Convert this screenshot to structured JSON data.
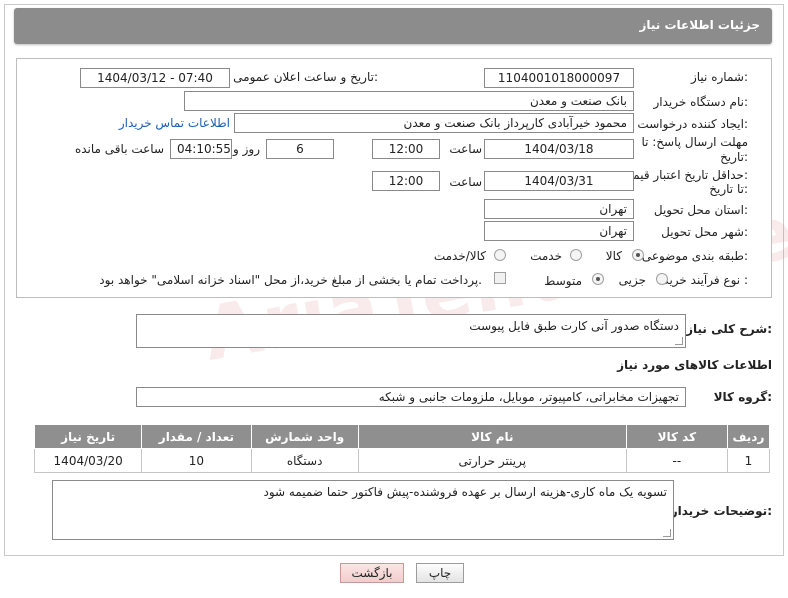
{
  "header": {
    "title": "جزئیات اطلاعات نیاز"
  },
  "form": {
    "need_number_label": "شماره نیاز:",
    "need_number": "1104001018000097",
    "announce_datetime_label": "تاریخ و ساعت اعلان عمومی:",
    "announce_datetime": "1404/03/12 - 07:40",
    "buyer_org_label": "نام دستگاه خریدار:",
    "buyer_org": "بانک صنعت و معدن",
    "requester_label": "ایجاد کننده درخواست:",
    "requester": "محمود خیرآبادی کارپرداز بانک صنعت و معدن",
    "buyer_contact_link": "اطلاعات تماس خریدار",
    "reply_deadline_label_1": "مهلت ارسال پاسخ: تا",
    "reply_deadline_label_2": "تاریخ:",
    "reply_date": "1404/03/18",
    "time_label": "ساعت",
    "reply_time": "12:00",
    "days_value": "6",
    "days_label": "روز و",
    "remaining_time": "04:10:55",
    "remaining_label": "ساعت باقی مانده",
    "price_validity_label_1": "حداقل تاریخ اعتبار قیمت:",
    "price_validity_label_2": "تا تاریخ:",
    "price_date": "1404/03/31",
    "price_time": "12:00",
    "province_label": "استان محل تحویل:",
    "province": "تهران",
    "city_label": "شهر محل تحویل:",
    "city": "تهران",
    "category_label": "طبقه بندی موضوعی:",
    "category_options": [
      "کالا",
      "خدمت",
      "کالا/خدمت"
    ],
    "purchase_type_label": "نوع فرآیند خرید :",
    "purchase_options": [
      "جزیی",
      "متوسط"
    ],
    "payment_note": "پرداخت تمام یا بخشی از مبلغ خرید،از محل \"اسناد خزانه اسلامی\" خواهد بود."
  },
  "summary": {
    "label": "شرح کلی نیاز:",
    "text": "دستگاه صدور آنی کارت طبق فایل پیوست"
  },
  "goods": {
    "section_title": "اطلاعات کالاهای مورد نیاز",
    "group_label": "گروه کالا:",
    "group_value": "تجهیزات مخابراتی، کامپیوتر، موبایل، ملزومات جانبی و شبکه",
    "columns": [
      "ردیف",
      "کد کالا",
      "نام کالا",
      "واحد شمارش",
      "تعداد / مقدار",
      "تاریخ نیاز"
    ],
    "rows": [
      [
        "1",
        "--",
        "پرینتر حرارتی",
        "دستگاه",
        "10",
        "1404/03/20"
      ]
    ]
  },
  "buyer_notes": {
    "label": "توضیحات خریدار:",
    "text": "تسویه یک ماه کاری-هزینه ارسال بر عهده فروشنده-پیش فاکتور حتما ضمیمه شود"
  },
  "buttons": {
    "print": "چاپ",
    "back": "بازگشت"
  },
  "watermark": "AriaTender.neT"
}
